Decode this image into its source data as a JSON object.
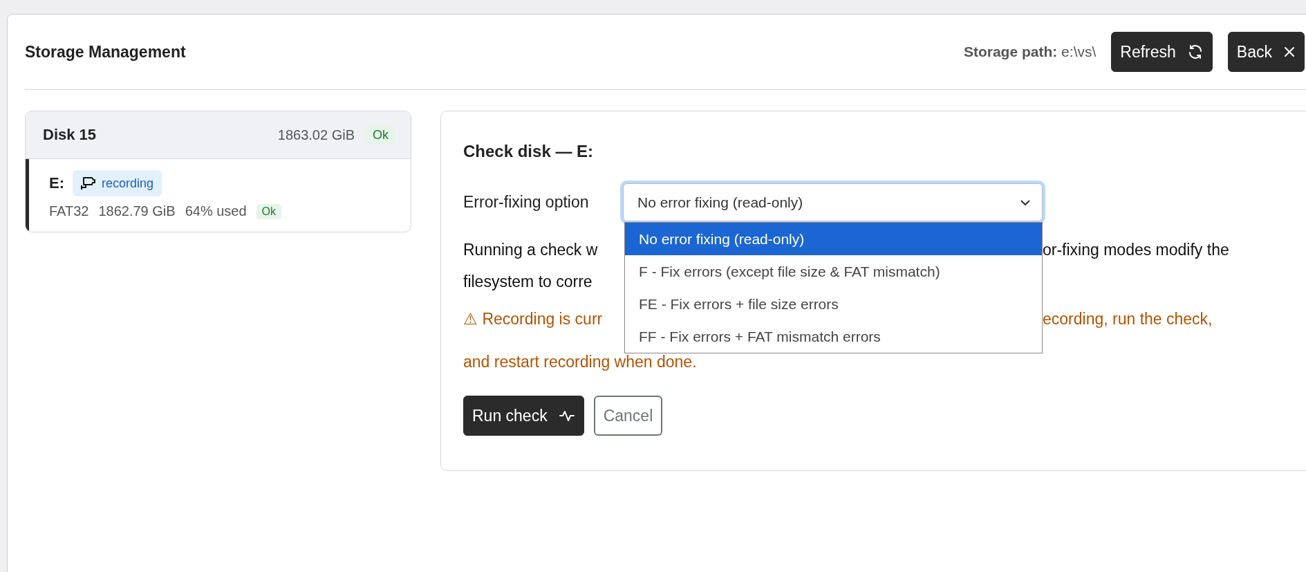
{
  "window": {
    "title": "Storage Management"
  },
  "header": {
    "storage_path": "**Storage path:** e:\\vs\\",
    "buttons": [
      {
        "label": "Refresh",
        "kind": "refresh"
      },
      {
        "label": "Back",
        "kind": "close"
      }
    ]
  },
  "disks": [
    {
      "name": "Disk 15",
      "size": "1863.02 GiB",
      "status": "Ok",
      "volumes": [
        {
          "letter": "E:",
          "tag": "recording",
          "filesystem": "FAT32",
          "size": "1862.79 GiB",
          "usage": "64% used",
          "status": "Ok",
          "selected": true
        }
      ]
    }
  ],
  "check_panel": {
    "title": "Check disk — E:",
    "option_label": "Error-fixing option",
    "select": {
      "value": "No error fixing (read-only)",
      "expanded": true,
      "options": [
        {
          "label": "No error fixing (read-only)",
          "selected": true
        },
        {
          "label": "F - Fix errors (except file size & FAT mismatch)",
          "selected": false
        },
        {
          "label": "FE - Fix errors + file size errors",
          "selected": false
        },
        {
          "label": "FF - Fix errors + FAT mismatch errors",
          "selected": false
        }
      ]
    },
    "description_lines": [
      {
        "left": "Running a check w",
        "right": "or-fixing modes modify the"
      },
      {
        "left": "filesystem to corre"
      }
    ],
    "warning_lines": [
      {
        "left": "⚠ Recording is curr",
        "right": "ecording, run the check,"
      },
      {
        "left": "and restart recording when done."
      }
    ],
    "buttons": [
      {
        "label": "Run check",
        "kind": "primary"
      },
      {
        "label": "Cancel",
        "kind": "secondary"
      }
    ]
  }
}
